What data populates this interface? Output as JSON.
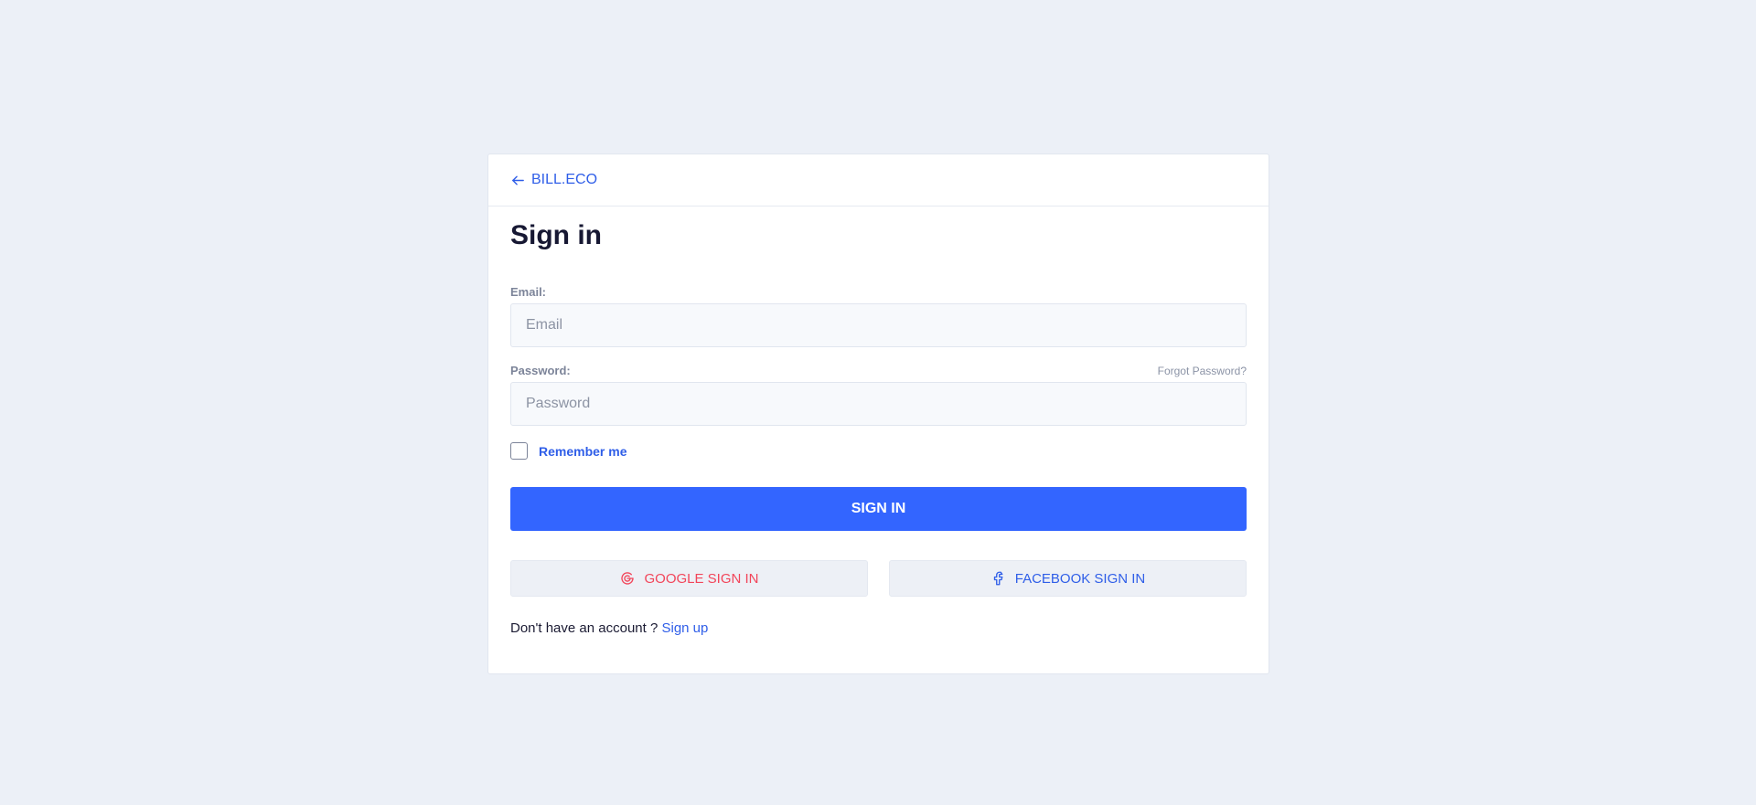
{
  "header": {
    "back_label": "BILL.ECO"
  },
  "form": {
    "title": "Sign in",
    "email": {
      "label": "Email:",
      "placeholder": "Email",
      "value": ""
    },
    "password": {
      "label": "Password:",
      "placeholder": "Password",
      "value": "",
      "forgot_label": "Forgot Password?"
    },
    "remember_label": "Remember me",
    "remember_checked": false,
    "submit_label": "SIGN IN"
  },
  "social": {
    "google_label": "GOOGLE SIGN IN",
    "facebook_label": "FACEBOOK SIGN IN"
  },
  "footer": {
    "prompt": "Don't have an account ?",
    "signup_label": "Sign up"
  },
  "colors": {
    "background": "#ecf0f7",
    "accent": "#3365ff",
    "link": "#2f5ee8",
    "google": "#f2455a"
  },
  "icons": {
    "back": "arrow-left-icon",
    "google": "google-icon",
    "facebook": "facebook-icon"
  }
}
